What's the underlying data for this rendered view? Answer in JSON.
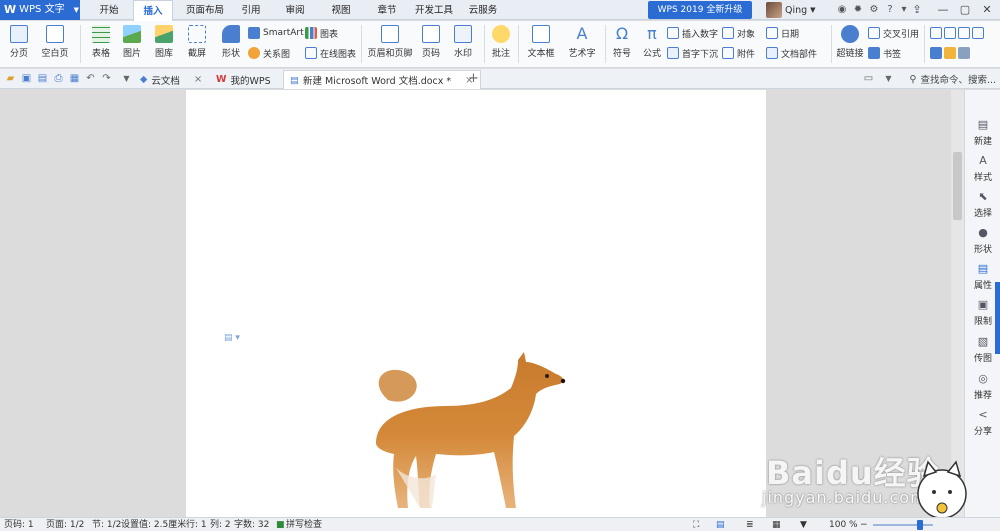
{
  "app": {
    "brand": "WPS 文字"
  },
  "menu": {
    "tabs": [
      "开始",
      "插入",
      "页面布局",
      "引用",
      "审阅",
      "视图",
      "章节",
      "开发工具",
      "云服务"
    ],
    "active_tab": "插入",
    "upgrade": "WPS 2019 全新升级",
    "user_name": "Qing"
  },
  "ribbon": {
    "page_break": "分页",
    "blank_page": "空白页",
    "table": "表格",
    "picture": "图片",
    "gallery": "图库",
    "screenshot": "截屏",
    "shape": "形状",
    "smartart": "SmartArt",
    "relation": "关系图",
    "chart": "图表",
    "online_chart": "在线图表",
    "header_footer": "页眉和页脚",
    "page_number": "页码",
    "watermark": "水印",
    "comment": "批注",
    "textbox": "文本框",
    "wordart": "艺术字",
    "symbol": "符号",
    "formula": "公式",
    "insert_number": "插入数字",
    "drop_cap": "首字下沉",
    "object": "对象",
    "attachment": "附件",
    "date": "日期",
    "doc_parts": "文档部件",
    "hyperlink": "超链接",
    "cross_ref": "交叉引用",
    "bookmark": "书签"
  },
  "doctabs": [
    {
      "label": "云文档"
    },
    {
      "label": "我的WPS"
    },
    {
      "label": "新建 Microsoft Word 文档.docx *"
    }
  ],
  "search": {
    "placeholder": "查找命令、搜索..."
  },
  "right_panel": [
    "新建",
    "样式",
    "选择",
    "形状",
    "属性",
    "限制",
    "传图",
    "推荐",
    "分享"
  ],
  "status": {
    "page_num": "页码: 1",
    "pages": "页面: 1/2",
    "section": "节: 1/2",
    "setting": "设置值: 2.5厘米",
    "row": "行: 1",
    "col": "列: 2",
    "words": "字数: 32",
    "spell": "拼写检查",
    "zoom": "100 %"
  },
  "watermark": {
    "logo": "Baidu经验",
    "url": "jingyan.baidu.com"
  },
  "colors": {
    "accent": "#2b6cd4",
    "workspace": "#dcdcdc"
  }
}
